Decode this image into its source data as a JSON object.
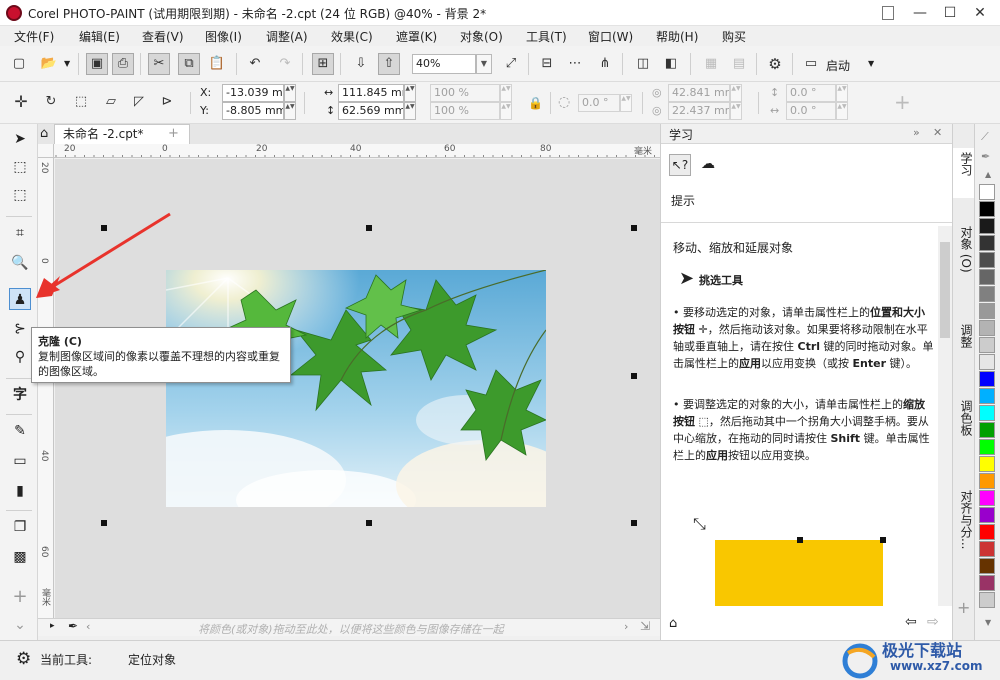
{
  "window": {
    "title": "Corel PHOTO-PAINT (试用期限到期) - 未命名 -2.cpt (24 位 RGB) @40% - 背景 2*",
    "minimize": "—",
    "maximize": "☐",
    "close": "✕"
  },
  "menu": [
    "文件(F)",
    "编辑(E)",
    "查看(V)",
    "图像(I)",
    "调整(A)",
    "效果(C)",
    "遮罩(K)",
    "对象(O)",
    "工具(T)",
    "窗口(W)",
    "帮助(H)",
    "购买"
  ],
  "standard_toolbar": {
    "zoom_value": "40%",
    "launch_label": "启动"
  },
  "property_bar": {
    "x_label": "X:",
    "x_value": "-13.039 mr",
    "y_label": "Y:",
    "y_value": "-8.805 mm",
    "width_value": "111.845 mm",
    "height_value": "62.569 mm",
    "scale_w": "100 %",
    "scale_h": "100 %",
    "rotation": "0.0 °",
    "center_x": "42.841 mm",
    "center_y": "22.437 mm",
    "skew_h": "0.0 °",
    "skew_v": "0.0 °"
  },
  "document": {
    "tab_label": "未命名 -2.cpt*",
    "ruler_h_labels": [
      "20",
      "0",
      "20",
      "40",
      "60",
      "80",
      "毫米"
    ],
    "ruler_v_labels": [
      "20",
      "0",
      "20",
      "40",
      "60",
      "毫米"
    ],
    "color_drop_hint": "将颜色(或对象)拖动至此处，以便将这些颜色与图像存储在一起"
  },
  "tooltip": {
    "title": "克隆 (C)",
    "description": "复制图像区域间的像素以覆盖不理想的内容或重复的图像区域。"
  },
  "docker": {
    "title": "学习",
    "hint_label": "提示",
    "heading": "移动、缩放和延展对象",
    "tool_name": "挑选工具",
    "bullet1_a": "要移动选定的对象，请单击属性栏上的",
    "bullet1_b": "位置和大小按钮",
    "bullet1_c": "，然后拖动该对象。如果要将移动限制在水平轴或垂直轴上，请在按住",
    "bullet1_d": "Ctrl",
    "bullet1_e": "键的同时拖动对象。单击属性栏上的",
    "bullet1_f": "应用",
    "bullet1_g": "以应用变换（或按",
    "bullet1_h": "Enter",
    "bullet1_i": "键）。",
    "bullet2_a": "要调整选定的对象的大小，请单击属性栏上的",
    "bullet2_b": "缩放按钮",
    "bullet2_c": "，然后拖动其中一个拐角大小调整手柄。要从中心缩放，在拖动的同时请按住",
    "bullet2_d": "Shift",
    "bullet2_e": "键。单击属性栏上的",
    "bullet2_f": "应用",
    "bullet2_g": "按钮以应用变换。"
  },
  "vertical_tabs": [
    "学习",
    "对象 (O)",
    "调整",
    "调色板",
    "对齐与分..."
  ],
  "palette_colors": [
    "#ffffff",
    "#000000",
    "#1a1a1a",
    "#333333",
    "#4d4d4d",
    "#666666",
    "#808080",
    "#999999",
    "#b3b3b3",
    "#cccccc",
    "#e6e6e6",
    "#0000ff",
    "#00b0ff",
    "#00ffff",
    "#00a000",
    "#00ff00",
    "#ffff00",
    "#ff9900",
    "#ff00ff",
    "#9900cc",
    "#ff0000",
    "#cc3333",
    "#663300",
    "#993366",
    "#cccccc"
  ],
  "status": {
    "current_tool_label": "当前工具:",
    "current_tool_value": "定位对象"
  },
  "watermark": {
    "name": "极光下载站",
    "url": "www.xz7.com"
  },
  "colors": {
    "app_red": "#c8102e",
    "active_tool": "#4d8fd1",
    "crop_yellow": "#f9c700"
  }
}
